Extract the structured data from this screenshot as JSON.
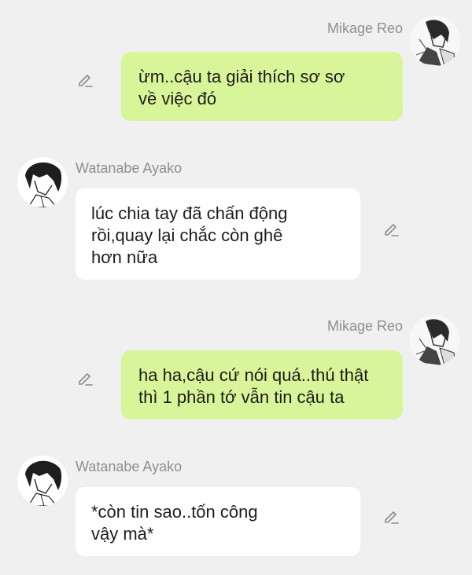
{
  "messages": [
    {
      "sender": "Mikage Reo",
      "side": "right",
      "text": "ừm..cậu ta giải thích sơ sơ\nvề việc đó"
    },
    {
      "sender": "Watanabe Ayako",
      "side": "left",
      "text": "lúc chia tay đã chấn động\nrồi,quay lại chắc còn ghê\nhơn nữa"
    },
    {
      "sender": "Mikage Reo",
      "side": "right",
      "text": "ha ha,cậu cứ nói quá..thú thật\nthì 1 phần tớ vẫn tin cậu ta"
    },
    {
      "sender": "Watanabe Ayako",
      "side": "left",
      "text": "*còn tin sao..tốn công\nvậy mà*"
    }
  ],
  "colors": {
    "background": "#f0f0f0",
    "own_bubble": "#d9f59a",
    "other_bubble": "#ffffff",
    "sender_name": "#8f8f8f",
    "message_text": "#1c1c1c",
    "edit_icon": "#8c8c8c"
  },
  "icons": {
    "edit": "pencil-edit-icon",
    "avatar_reo": "manga-avatar-reo",
    "avatar_ayako": "manga-avatar-ayako"
  }
}
